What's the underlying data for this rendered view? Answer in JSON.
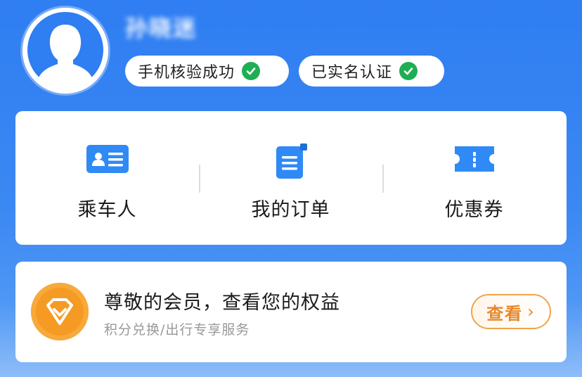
{
  "profile": {
    "username": "孙晓迷",
    "badges": [
      {
        "label": "手机核验成功"
      },
      {
        "label": "已实名认证"
      }
    ]
  },
  "quick_entries": [
    {
      "label": "乘车人",
      "icon": "passenger-card-icon"
    },
    {
      "label": "我的订单",
      "icon": "order-document-icon"
    },
    {
      "label": "优惠券",
      "icon": "coupon-ticket-icon"
    }
  ],
  "member": {
    "title": "尊敬的会员，查看您的权益",
    "subtitle": "积分兑换/出行专享服务",
    "button_label": "查看",
    "chevron": "›",
    "icon": "diamond-icon"
  },
  "colors": {
    "brand_blue": "#2f7ef2",
    "icon_blue": "#2f8af5",
    "success_green": "#1fae52",
    "member_orange": "#f7a93a"
  }
}
